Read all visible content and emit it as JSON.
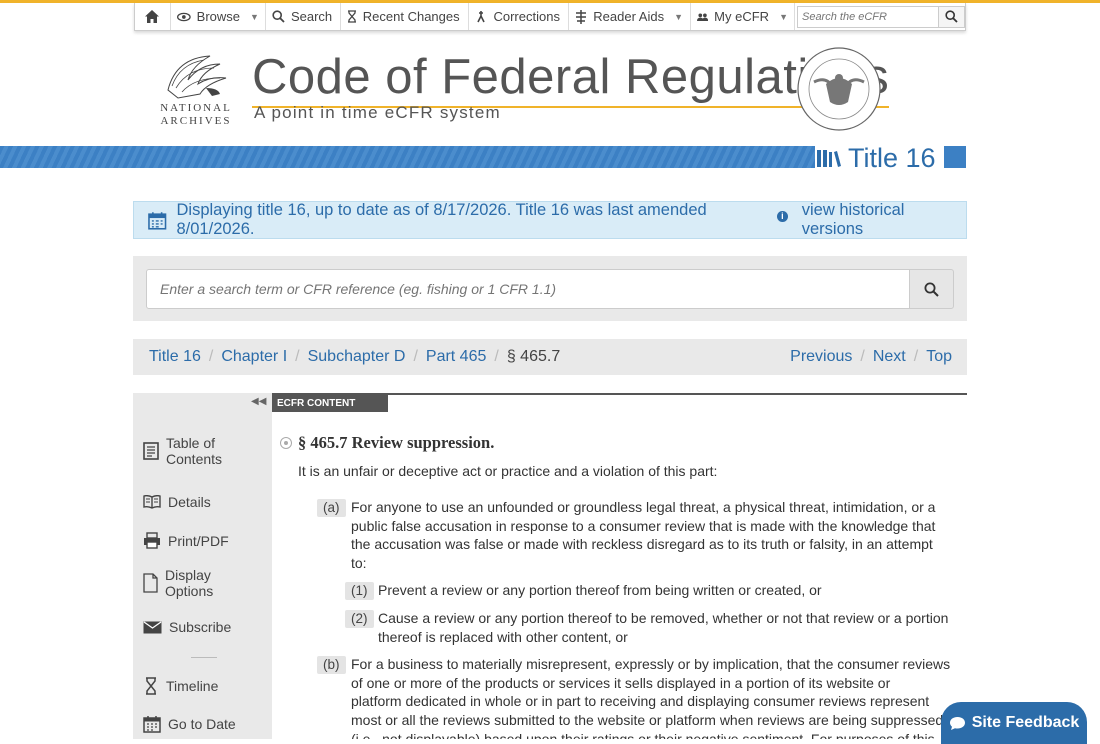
{
  "nav": {
    "browse": "Browse",
    "search": "Search",
    "recent_changes": "Recent Changes",
    "corrections": "Corrections",
    "reader_aids": "Reader Aids",
    "my_ecfr": "My eCFR",
    "search_placeholder": "Search the eCFR"
  },
  "header": {
    "logo_text_line1": "NATIONAL",
    "logo_text_line2": "ARCHIVES",
    "title": "Code of Federal Regulations",
    "subtitle": "A point in time eCFR system",
    "title_tag": "Title 16"
  },
  "alert": {
    "message": "Displaying title 16, up to date as of 8/17/2026. Title 16 was last amended 8/01/2026.",
    "info_glyph": "i",
    "link": "view historical versions"
  },
  "search": {
    "placeholder": "Enter a search term or CFR reference (eg. fishing or 1 CFR 1.1)"
  },
  "breadcrumb": {
    "items": [
      "Title 16",
      "Chapter I",
      "Subchapter D",
      "Part 465"
    ],
    "current": "§ 465.7",
    "previous": "Previous",
    "next": "Next",
    "top": "Top"
  },
  "sidebar": {
    "items": [
      {
        "label": "Table of Contents",
        "line1": "Table of",
        "line2": "Contents"
      },
      {
        "label": "Details"
      },
      {
        "label": "Print/PDF"
      },
      {
        "label": "Display Options",
        "line1": "Display",
        "line2": "Options"
      },
      {
        "label": "Subscribe"
      },
      {
        "label": "Timeline"
      },
      {
        "label": "Go to Date"
      }
    ]
  },
  "content": {
    "tab": "ECFR CONTENT",
    "section_title": "§ 465.7 Review suppression.",
    "intro": "It is an unfair or deceptive act or practice and a violation of this part:",
    "paragraphs": [
      {
        "mark": "(a)",
        "lines": [
          "For anyone to use an unfounded or groundless legal threat, a physical threat, intimidation, or a",
          "public false accusation in response to a consumer review that is made with the knowledge that",
          "the accusation was false or made with reckless disregard as to its truth or falsity, in an attempt",
          "to:"
        ]
      },
      {
        "mark": "(1)",
        "lines": [
          "Prevent a review or any portion thereof from being written or created, or"
        ]
      },
      {
        "mark": "(2)",
        "lines": [
          "Cause a review or any portion thereof to be removed, whether or not that review or a portion",
          "thereof is replaced with other content, or"
        ]
      },
      {
        "mark": "(b)",
        "lines": [
          "For a business to materially misrepresent, expressly or by implication, that the consumer reviews",
          "of one or more of the products or services it sells displayed in a portion of its website or",
          "platform dedicated in whole or in part to receiving and displaying consumer reviews represent",
          "most or all the reviews submitted to the website or platform when reviews are being suppressed",
          "(i.e., not displayable) based upon their ratings or their negative sentiment. For purposes of this"
        ]
      }
    ]
  },
  "feedback": "Site Feedback"
}
